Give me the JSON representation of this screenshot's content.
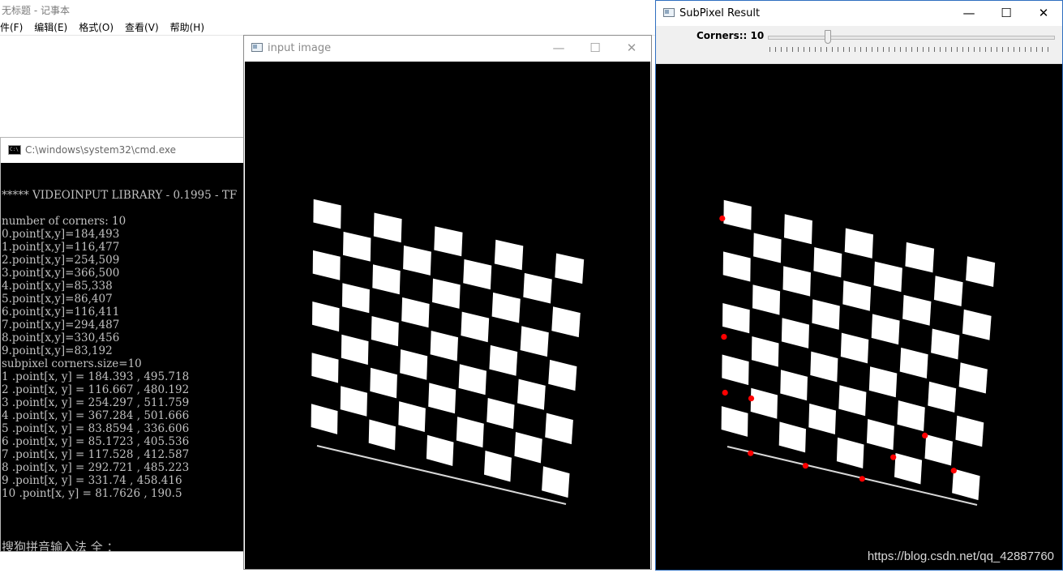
{
  "notepad": {
    "title": "无标题 - 记事本",
    "menu": [
      "件(F)",
      "编辑(E)",
      "格式(O)",
      "查看(V)",
      "帮助(H)"
    ]
  },
  "cmd": {
    "title": "C:\\windows\\system32\\cmd.exe",
    "icon_text": "C:\\",
    "lines": [
      "",
      "***** VIDEOINPUT LIBRARY - 0.1995 - TF",
      "",
      "number of corners: 10",
      "0.point[x,y]=184,493",
      "1.point[x,y]=116,477",
      "2.point[x,y]=254,509",
      "3.point[x,y]=366,500",
      "4.point[x,y]=85,338",
      "5.point[x,y]=86,407",
      "6.point[x,y]=116,411",
      "7.point[x,y]=294,487",
      "8.point[x,y]=330,456",
      "9.point[x,y]=83,192",
      "subpixel corners.size=10",
      "1 .point[x, y] = 184.393 , 495.718",
      "2 .point[x, y] = 116.667 , 480.192",
      "3 .point[x, y] = 254.297 , 511.759",
      "4 .point[x, y] = 367.284 , 501.666",
      "5 .point[x, y] = 83.8594 , 336.606",
      "6 .point[x, y] = 85.1723 , 405.536",
      "7 .point[x, y] = 117.528 , 412.587",
      "8 .point[x, y] = 292.721 , 485.223",
      "9 .point[x, y] = 331.74 , 458.416",
      "10 .point[x, y] = 81.7626 , 190.5"
    ],
    "ime_text": "搜狗拼音输入法 全 ："
  },
  "input_window": {
    "title": "input image",
    "minimize": "—",
    "maximize": "☐",
    "close": "✕"
  },
  "subpixel_window": {
    "title": "SubPixel Result",
    "minimize": "—",
    "maximize": "☐",
    "close": "✕",
    "trackbar_label": "Corners:: 10",
    "trackbar_value": 10,
    "corner_color": "#ff0000",
    "corners": [
      [
        184.393,
        495.718
      ],
      [
        116.667,
        480.192
      ],
      [
        254.297,
        511.759
      ],
      [
        367.284,
        501.666
      ],
      [
        83.8594,
        336.606
      ],
      [
        85.1723,
        405.536
      ],
      [
        117.528,
        412.587
      ],
      [
        292.721,
        485.223
      ],
      [
        331.74,
        458.416
      ],
      [
        81.7626,
        190.5
      ]
    ]
  },
  "watermark": "https://blog.csdn.net/qq_42887760"
}
